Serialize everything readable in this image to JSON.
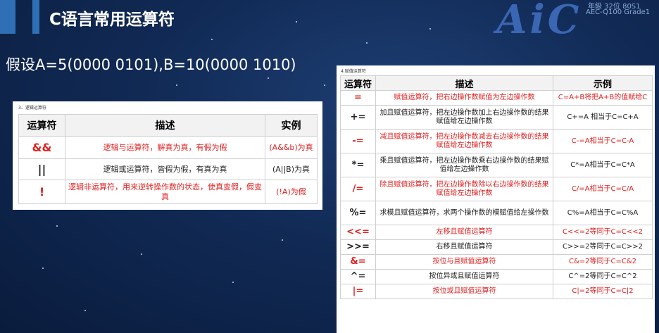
{
  "header": {
    "title": "C语言常用运算符",
    "subtitle": "假设A=5(0000 0101),B=10(0000 1010)",
    "logo_text": "AiC",
    "logo_line1": "年級 32位 80S1",
    "logo_line2": "AEC-Q100 Grade1"
  },
  "logic_table": {
    "caption": "3、逻辑运算符",
    "headers": [
      "运算符",
      "描述",
      "实例"
    ],
    "rows": [
      {
        "op": "&&",
        "desc": "逻辑与运算符，解真为真，有假为假",
        "example": "(A&&b)为真",
        "color": "#e02020"
      },
      {
        "op": "||",
        "desc": "逻辑或运算符，皆假为假，有真为真",
        "example": "(A||B)为真",
        "color": "#222222"
      },
      {
        "op": "!",
        "desc": "逻辑非运算符，用来逆转操作数的状态，使真变假，假变真",
        "example": "(!A)为假",
        "color": "#e02020"
      }
    ]
  },
  "assign_table": {
    "caption": "4.赋值运算符",
    "headers": [
      "运算符",
      "描述",
      "示例"
    ],
    "rows": [
      {
        "op": "=",
        "desc": "赋值运算符，把右边操作数赋值为左边操作数",
        "example": "C=A+B将把A+B的值赋给C",
        "color": "#e02020"
      },
      {
        "op": "+=",
        "desc": "加且赋值运算符，把左边操作数加上右边操作数的结果赋值给左边操作数",
        "example": "C+=A 相当于C=C+A",
        "color": "#222222"
      },
      {
        "op": "-=",
        "desc": "减且赋值运算符，把左边操作数减去右边操作数的结果赋值给左边操作数",
        "example": "C-=A相当于C=C-A",
        "color": "#e02020"
      },
      {
        "op": "*=",
        "desc": "乘且赋值运算符，把左边操作数乘右边操作数的结果赋值给左边操作数",
        "example": "C*=A相当于C=C*A",
        "color": "#222222"
      },
      {
        "op": "/=",
        "desc": "除且赋值运算符，把左边操作数除以右边操作数的结果赋值给左边操作数",
        "example": "C/=A相当于C=C/A",
        "color": "#e02020"
      },
      {
        "op": "%=",
        "desc": "求模且赋值运算符，求两个操作数的模赋值给左操作数",
        "example": "C%=A相当于C=C%A",
        "color": "#222222"
      },
      {
        "op": "<<=",
        "desc": "左移且赋值运算符",
        "example": "C<<=2等同于C=C<<2",
        "color": "#e02020"
      },
      {
        "op": ">>=",
        "desc": "右移且赋值运算符",
        "example": "C>>=2等同于C=C>>2",
        "color": "#222222"
      },
      {
        "op": "&=",
        "desc": "按位与且赋值运算符",
        "example": "C&=2等同于C=C&2",
        "color": "#e02020"
      },
      {
        "op": "^=",
        "desc": "按位异或且赋值运算符",
        "example": "C^=2等同于C=C^2",
        "color": "#222222"
      },
      {
        "op": "|=",
        "desc": "按位或且赋值运算符",
        "example": "C|=2等同于C=C|2",
        "color": "#e02020"
      }
    ]
  }
}
